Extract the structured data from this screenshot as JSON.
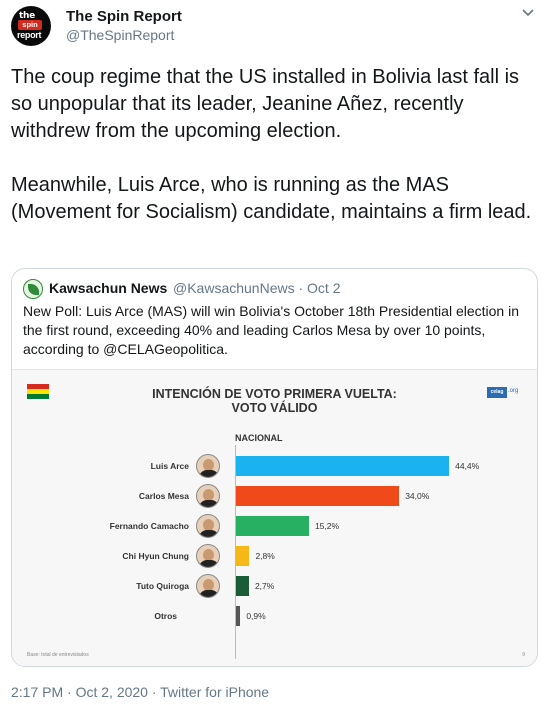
{
  "tweet": {
    "author_name": "The Spin Report",
    "author_handle": "@TheSpinReport",
    "avatar_lines": [
      "the",
      "spin",
      "report"
    ],
    "text": "The coup regime that the US installed in Bolivia last fall is so unpopular that its leader, Jeanine Añez, recently withdrew from the upcoming election.\n\nMeanwhile, Luis Arce, who is running as the MAS (Movement for Socialism) candidate, maintains a firm lead.",
    "timestamp": "2:17 PM · Oct 2, 2020 · Twitter for iPhone"
  },
  "quoted": {
    "author_name": "Kawsachun News",
    "meta": "@KawsachunNews · Oct 2",
    "text": "New Poll: Luis Arce (MAS) will win Bolivia's October 18th Presidential election in the first round, exceeding  40% and leading Carlos Mesa by over 10 points, according to @CELAGeopolitica."
  },
  "chart_data": {
    "type": "bar",
    "orientation": "horizontal",
    "title": "INTENCIÓN DE VOTO PRIMERA VUELTA:",
    "subtitle": "VOTO VÁLIDO",
    "series_label": "NACIONAL",
    "logo_text": "celag",
    "logo_suffix": ".org",
    "footnote": "Base: total de entrevistados",
    "page_number": "9",
    "categories": [
      "Luis Arce",
      "Carlos Mesa",
      "Fernando Camacho",
      "Chi Hyun Chung",
      "Tuto Quiroga",
      "Otros"
    ],
    "values": [
      44.4,
      34.0,
      15.2,
      2.8,
      2.7,
      0.9
    ],
    "value_labels": [
      "44,4%",
      "34,0%",
      "15,2%",
      "2,8%",
      "2,7%",
      "0,9%"
    ],
    "colors": [
      "#1ab3ef",
      "#f04a1a",
      "#27b061",
      "#f6b816",
      "#1a5c37",
      "#555555"
    ],
    "xlim": [
      0,
      50
    ],
    "grid": false
  },
  "colors": {
    "link": "#1da1f2",
    "secondary_text": "#657786",
    "bolivia_flag": [
      "#d52b1e",
      "#f9e300",
      "#007934"
    ]
  },
  "icons": {
    "menu": "chevron-down-icon"
  }
}
